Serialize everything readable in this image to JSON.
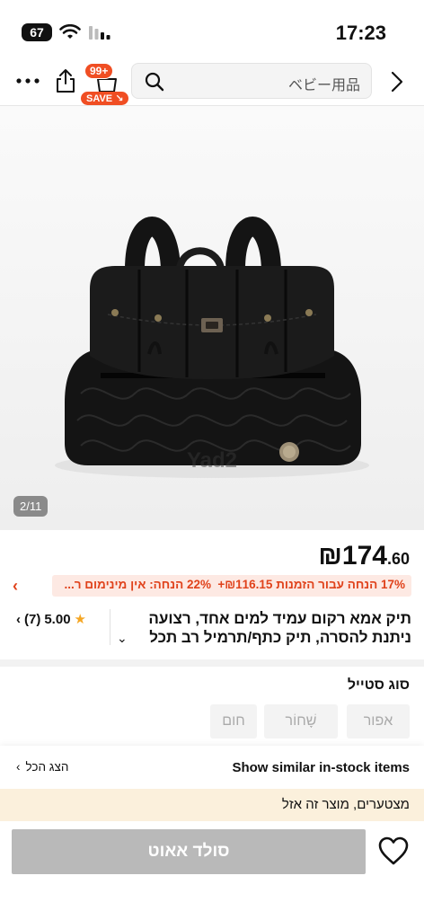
{
  "status_bar": {
    "battery": "67",
    "time": "17:23"
  },
  "top_bar": {
    "more_icon": "more-horizontal-icon",
    "cart_count": "99+",
    "save_badge": "SAVE",
    "search_placeholder": "ベビー用品"
  },
  "product": {
    "image_counter": "2/11",
    "watermark": "Yad2",
    "price_currency": "₪",
    "price_main": "174",
    "price_decimal": ".60",
    "coupons": [
      "17% הנחה עבור הזמנות ₪116.15+",
      "22% הנחה: אין מינימום ר..."
    ],
    "title": "תיק אמא רקום עמיד למים אחד, רצועה ניתנת להסרה, תיק כתף/תרמיל רב תכל",
    "rating": "5.00",
    "review_count": "(7)"
  },
  "style_section": {
    "label": "סוג סטייל",
    "options": [
      "אפור",
      "שָׁחוֹר",
      "חום"
    ]
  },
  "similar": {
    "text": "Show similar in-stock items",
    "show_all": "הצג הכל"
  },
  "notice": "מצטערים, מוצר זה אזל",
  "bottom": {
    "soldout_label": "סולד אאוט"
  },
  "colors": {
    "accent": "#f04e23",
    "coupon_bg": "#fde9e3",
    "notice_bg": "#fbf0dc",
    "disabled_button": "#b9b9b9"
  }
}
